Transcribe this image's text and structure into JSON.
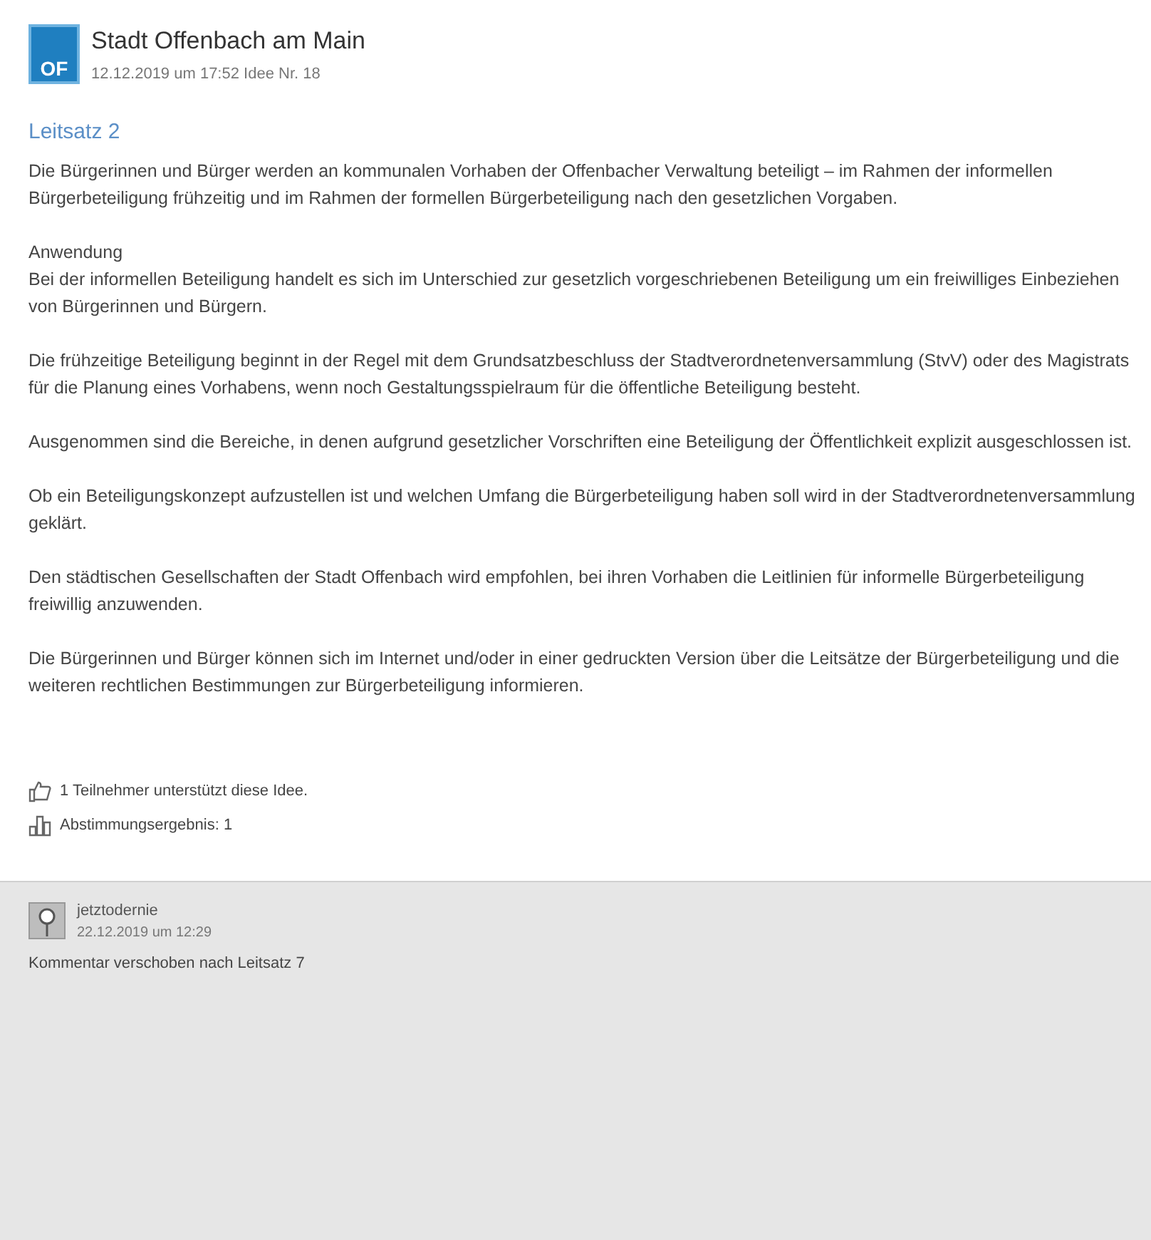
{
  "header": {
    "logo": "OF",
    "author": "Stadt Offenbach am Main",
    "meta": "12.12.2019 um 17:52 Idee Nr. 18"
  },
  "title": "Leitsatz 2",
  "paragraphs": [
    {
      "kind": "text",
      "text": "Die Bürgerinnen und Bürger werden an kommunalen Vorhaben der Offenbacher Verwaltung beteiligt – im Rahmen der informellen Bürgerbeteiligung frühzeitig und im Rahmen der formellen Bürgerbeteiligung nach den gesetzlichen Vorgaben."
    },
    {
      "kind": "headed",
      "heading": "Anwendung",
      "text": "Bei der informellen Beteiligung handelt es sich im Unterschied zur gesetzlich vorgeschriebenen Beteiligung um ein freiwilliges Einbeziehen von Bürgerinnen und Bürgern."
    },
    {
      "kind": "text",
      "text": "Die frühzeitige Beteiligung beginnt in der Regel mit dem Grundsatzbeschluss der Stadtverordnetenversammlung (StvV) oder des Magistrats für die Planung eines Vorhabens, wenn noch Gestaltungsspielraum für die öffentliche Beteiligung besteht."
    },
    {
      "kind": "text",
      "text": "Ausgenommen sind die Bereiche, in denen aufgrund gesetzlicher Vorschriften eine Beteiligung der Öffentlichkeit explizit ausgeschlossen ist."
    },
    {
      "kind": "text",
      "text": "Ob ein Beteiligungskonzept aufzustellen ist und welchen Umfang die Bürgerbeteiligung haben soll wird in der Stadtverordnetenversammlung geklärt."
    },
    {
      "kind": "text",
      "text": "Den städtischen Gesellschaften der Stadt Offenbach wird empfohlen, bei ihren Vorhaben die Leitlinien für informelle Bürgerbeteiligung freiwillig anzuwenden."
    },
    {
      "kind": "text",
      "text": "Die Bürgerinnen und Bürger können sich im Internet und/oder in einer gedruckten Version über die Leitsätze der Bürgerbeteiligung und die weiteren rechtlichen Bestimmungen zur Bürgerbeteiligung informieren."
    }
  ],
  "stats": [
    {
      "kind": "support",
      "text": "1 Teilnehmer unterstützt diese Idee."
    },
    {
      "kind": "vote",
      "text": "Abstimmungsergebnis: 1"
    }
  ],
  "comment": {
    "author": "jetztodernie",
    "date": "22.12.2019 um 12:29",
    "text": "Kommentar verschoben nach Leitsatz 7"
  }
}
